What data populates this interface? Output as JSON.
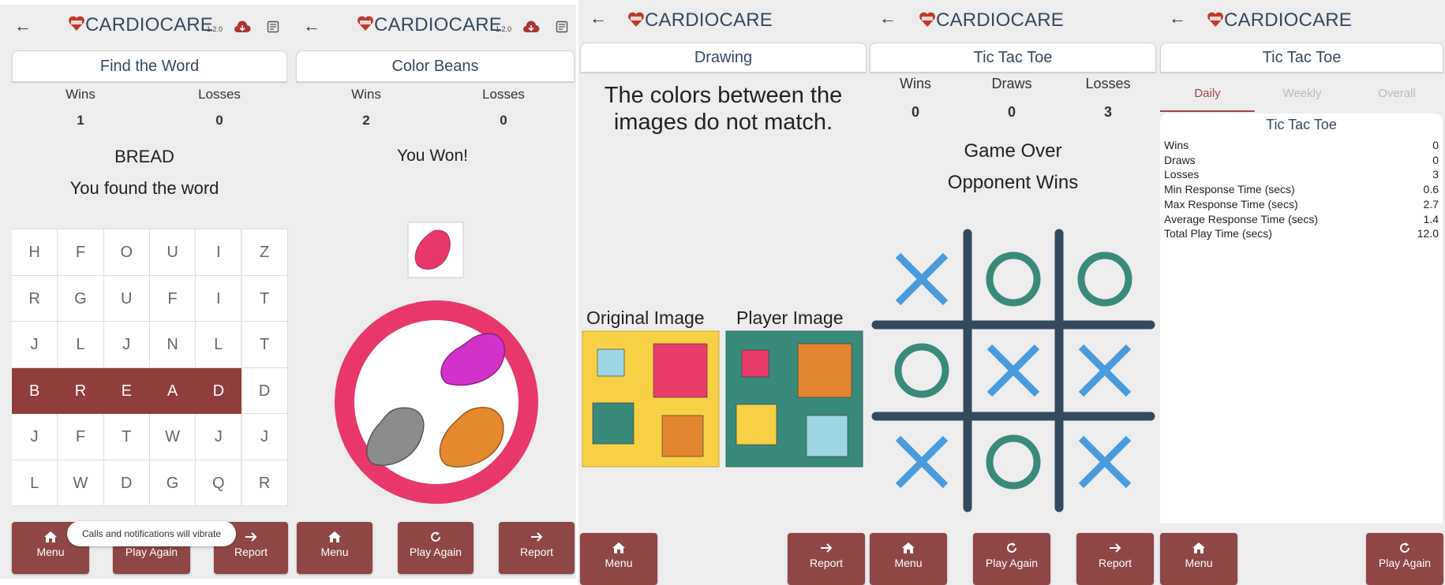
{
  "header": {
    "brand": "CARDIOCARE",
    "version": "1.2.0"
  },
  "panel1": {
    "title": "Find the Word",
    "wins_label": "Wins",
    "losses_label": "Losses",
    "wins": "1",
    "losses": "0",
    "word": "BREAD",
    "message": "You found the word",
    "grid": [
      [
        "H",
        "F",
        "O",
        "U",
        "I",
        "Z"
      ],
      [
        "R",
        "G",
        "U",
        "F",
        "I",
        "T"
      ],
      [
        "J",
        "L",
        "J",
        "N",
        "L",
        "T"
      ],
      [
        "B",
        "R",
        "E",
        "A",
        "D",
        "D"
      ],
      [
        "J",
        "F",
        "T",
        "W",
        "J",
        "J"
      ],
      [
        "L",
        "W",
        "D",
        "G",
        "Q",
        "R"
      ]
    ],
    "toast": "Calls and notifications will vibrate",
    "buttons": {
      "menu": "Menu",
      "play_again": "Play Again",
      "report": "Report"
    }
  },
  "panel2": {
    "title": "Color Beans",
    "wins_label": "Wins",
    "losses_label": "Losses",
    "wins": "2",
    "losses": "0",
    "message": "You Won!",
    "buttons": {
      "menu": "Menu",
      "play_again": "Play Again",
      "report": "Report"
    },
    "colors": {
      "target": "#e8386b",
      "ring": "#e8386b",
      "purple": "#d232c8",
      "gray": "#8c8c8c",
      "orange": "#e6882e"
    }
  },
  "panel3": {
    "title": "Drawing",
    "message": "The colors between the images do not match.",
    "original_label": "Original Image",
    "player_label": "Player Image",
    "buttons": {
      "menu": "Menu",
      "report": "Report"
    },
    "colors": {
      "yellow": "#f7d046",
      "teal": "#3a8a7c",
      "pink": "#e83c6a",
      "lightblue": "#9dd6e3",
      "orange": "#e3862f"
    }
  },
  "panel4": {
    "title": "Tic Tac Toe",
    "wins_label": "Wins",
    "draws_label": "Draws",
    "losses_label": "Losses",
    "wins": "0",
    "draws": "0",
    "losses": "3",
    "line1": "Game Over",
    "line2": "Opponent Wins",
    "board": [
      "X",
      "O",
      "O",
      "O",
      "X",
      "X",
      "X",
      "O",
      "X"
    ],
    "buttons": {
      "menu": "Menu",
      "play_again": "Play Again",
      "report": "Report"
    },
    "colors": {
      "x": "#4a9bdb",
      "o": "#3a8a7c",
      "grid": "#34495e"
    }
  },
  "panel5": {
    "title": "Tic Tac Toe",
    "tabs": [
      "Daily",
      "Weekly",
      "Overall"
    ],
    "card_title": "Tic Tac Toe",
    "stats": [
      {
        "label": "Wins",
        "value": "0"
      },
      {
        "label": "Draws",
        "value": "0"
      },
      {
        "label": "Losses",
        "value": "3"
      },
      {
        "label": "Min Response Time (secs)",
        "value": "0.6"
      },
      {
        "label": "Max Response Time (secs)",
        "value": "2.7"
      },
      {
        "label": "Average Response Time (secs)",
        "value": "1.4"
      },
      {
        "label": "Total Play Time (secs)",
        "value": "12.0"
      }
    ],
    "buttons": {
      "menu": "Menu",
      "play_again": "Play Again"
    }
  },
  "theme": {
    "accent": "#8f4646",
    "title_text": "#34495e",
    "background": "#ededee"
  }
}
